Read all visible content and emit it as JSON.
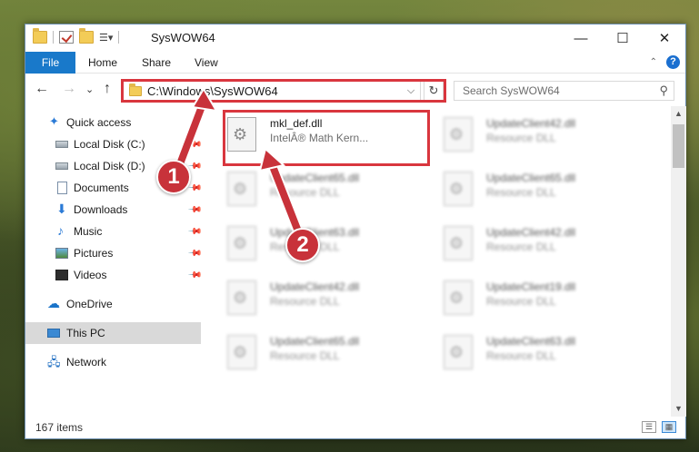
{
  "window": {
    "title": "SysWOW64",
    "minimize": "—",
    "maximize": "☐",
    "close": "✕"
  },
  "ribbon": {
    "tabs": [
      "File",
      "Home",
      "Share",
      "View"
    ],
    "collapse_icon": "chevron-up-icon",
    "help": "?"
  },
  "address": {
    "path": "C:\\Windows\\SysWOW64",
    "dropdown": "⌵",
    "refresh": "↻",
    "back": "←",
    "forward": "→",
    "recent": "⌄",
    "up": "↑"
  },
  "search": {
    "placeholder": "Search SysWOW64",
    "icon": "search-icon"
  },
  "sidebar": {
    "items": [
      {
        "label": "Quick access",
        "icon": "star-icon",
        "pinned": false
      },
      {
        "label": "Local Disk (C:)",
        "icon": "disk-icon",
        "pinned": true
      },
      {
        "label": "Local Disk (D:)",
        "icon": "disk-icon",
        "pinned": true
      },
      {
        "label": "Documents",
        "icon": "document-icon",
        "pinned": true
      },
      {
        "label": "Downloads",
        "icon": "download-icon",
        "pinned": true
      },
      {
        "label": "Music",
        "icon": "music-icon",
        "pinned": true
      },
      {
        "label": "Pictures",
        "icon": "pictures-icon",
        "pinned": true
      },
      {
        "label": "Videos",
        "icon": "videos-icon",
        "pinned": true
      },
      {
        "label": "OneDrive",
        "icon": "cloud-icon",
        "pinned": false
      },
      {
        "label": "This PC",
        "icon": "computer-icon",
        "pinned": false,
        "selected": true
      },
      {
        "label": "Network",
        "icon": "network-icon",
        "pinned": false
      }
    ]
  },
  "files": [
    {
      "name": "mkl_def.dll",
      "type": "IntelÂ® Math Kern...",
      "highlighted": true
    },
    {
      "name": "UpdateClient42.dll",
      "type": "Resource DLL"
    },
    {
      "name": "UpdateClient65.dll",
      "type": "Resource DLL"
    },
    {
      "name": "UpdateClient65.dll",
      "type": "Resource DLL"
    },
    {
      "name": "UpdateClient63.dll",
      "type": "Resource DLL"
    },
    {
      "name": "UpdateClient42.dll",
      "type": "Resource DLL"
    },
    {
      "name": "UpdateClient42.dll",
      "type": "Resource DLL"
    },
    {
      "name": "UpdateClient19.dll",
      "type": "Resource DLL"
    },
    {
      "name": "UpdateClient65.dll",
      "type": "Resource DLL"
    },
    {
      "name": "UpdateClient63.dll",
      "type": "Resource DLL"
    }
  ],
  "status": {
    "item_count": "167 items"
  },
  "callouts": [
    "1",
    "2"
  ],
  "colors": {
    "accent": "#1979ca",
    "highlight": "#d9363e",
    "callout": "#c8323a"
  }
}
